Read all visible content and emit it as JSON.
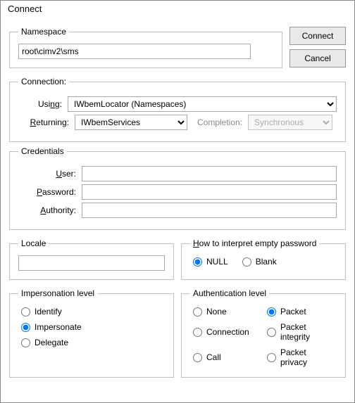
{
  "window": {
    "title": "Connect"
  },
  "buttons": {
    "connect": "Connect",
    "cancel": "Cancel"
  },
  "namespace": {
    "legend": "Namespace",
    "value": "root\\cimv2\\sms"
  },
  "connection": {
    "legend": "Connection:",
    "using_label": "Usi",
    "using_u": "n",
    "using_label2": "g:",
    "using_value": "IWbemLocator (Namespaces)",
    "returning_u": "R",
    "returning_label": "eturning:",
    "returning_value": "IWbemServices",
    "completion_label": "Completion:",
    "completion_value": "Synchronous"
  },
  "credentials": {
    "legend": "Credentials",
    "user_u": "U",
    "user_label": "ser:",
    "password_u": "P",
    "password_label": "assword:",
    "authority_u": "A",
    "authority_label": "uthority:",
    "user": "",
    "password": "",
    "authority": ""
  },
  "locale": {
    "legend": "Locale",
    "value": ""
  },
  "empty_pw": {
    "legend_u": "H",
    "legend_rest": "ow to interpret empty password",
    "null": "NULL",
    "blank": "Blank"
  },
  "impersonation": {
    "legend": "Impersonation level",
    "identify": "Identify",
    "impersonate": "Impersonate",
    "delegate": "Delegate"
  },
  "authentication": {
    "legend": "Authentication level",
    "none": "None",
    "connection": "Connection",
    "call": "Call",
    "packet": "Packet",
    "packet_integrity": "Packet integrity",
    "packet_privacy": "Packet privacy"
  }
}
